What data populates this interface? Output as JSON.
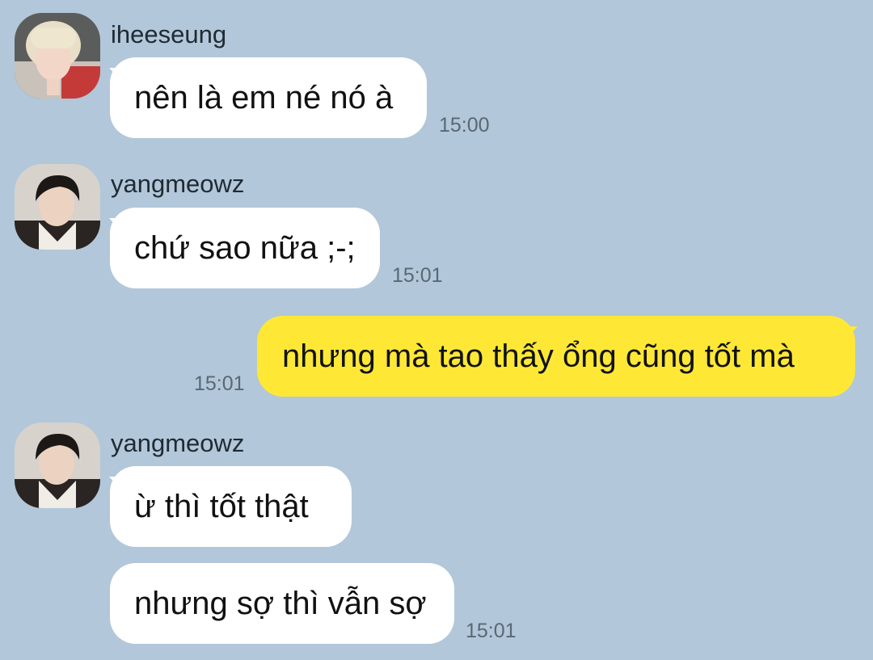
{
  "chat": {
    "messages": [
      {
        "sender": "iheeseung",
        "avatar": "iheeseung-avatar",
        "text": "nên là em né nó à",
        "time": "15:00",
        "direction": "incoming"
      },
      {
        "sender": "yangmeowz",
        "avatar": "yangmeowz-avatar",
        "text": "chứ sao nữa ;-;",
        "time": "15:01",
        "direction": "incoming"
      },
      {
        "sender": "",
        "text": "nhưng mà tao thấy ổng cũng tốt mà",
        "time": "15:01",
        "direction": "outgoing"
      },
      {
        "sender": "yangmeowz",
        "avatar": "yangmeowz-avatar",
        "text": "ừ thì tốt thật",
        "direction": "incoming"
      },
      {
        "text": "nhưng sợ thì vẫn sợ",
        "time": "15:01",
        "direction": "incoming"
      }
    ]
  },
  "colors": {
    "background": "#b2c7d9",
    "incoming_bubble": "#ffffff",
    "outgoing_bubble": "#fee835",
    "timestamp": "#5a6873"
  }
}
